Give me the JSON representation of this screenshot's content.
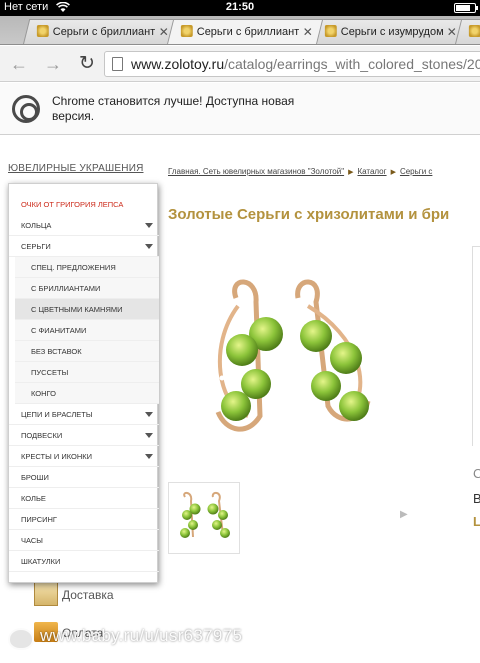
{
  "status_bar": {
    "carrier": "Нет сети",
    "time": "21:50",
    "battery_level": 0.8
  },
  "tabs": [
    {
      "title": "Серьги с бриллиант",
      "active": false
    },
    {
      "title": "Серьги с бриллиант",
      "active": true
    },
    {
      "title": "Серьги с изумрудом",
      "active": false
    }
  ],
  "toolbar": {
    "url_host": "www.zolotoy.ru",
    "url_path": "/catalog/earrings_with_colored_stones/20"
  },
  "infobar": {
    "message": "Chrome становится лучше! Доступна новая версия."
  },
  "site": {
    "catalog_link": "ЮВЕЛИРНЫЕ УКРАШЕНИЯ",
    "breadcrumb": [
      "Главная. Сеть ювелирных магазинов \"Золотой\"",
      "Каталог",
      "Серьги с"
    ],
    "page_title": "Золотые Серьги с хризолитами и бри",
    "right_panel": {
      "a": "С",
      "b": "В",
      "c": "L"
    },
    "delivery_label": "Доставка",
    "payment_label": "Оплата"
  },
  "menu": {
    "items": [
      {
        "label": "Очки от Григория Лепса",
        "type": "red"
      },
      {
        "label": "Кольца",
        "type": "top",
        "arrow": true
      },
      {
        "label": "Серьги",
        "type": "top",
        "arrow": true
      },
      {
        "label": "Спец. предложения",
        "type": "sub"
      },
      {
        "label": "С бриллиантами",
        "type": "sub"
      },
      {
        "label": "С цветными камнями",
        "type": "sub",
        "active": true
      },
      {
        "label": "С фианитами",
        "type": "sub"
      },
      {
        "label": "Без вставок",
        "type": "sub"
      },
      {
        "label": "Пуссеты",
        "type": "sub"
      },
      {
        "label": "Конго",
        "type": "sub"
      },
      {
        "label": "Цепи и браслеты",
        "type": "top",
        "arrow": true
      },
      {
        "label": "Подвески",
        "type": "top",
        "arrow": true
      },
      {
        "label": "Кресты и иконки",
        "type": "top",
        "arrow": true
      },
      {
        "label": "Броши",
        "type": "top"
      },
      {
        "label": "Колье",
        "type": "top"
      },
      {
        "label": "Пирсинг",
        "type": "top"
      },
      {
        "label": "Часы",
        "type": "top"
      },
      {
        "label": "Шкатулки",
        "type": "top"
      }
    ]
  },
  "watermark": {
    "text": "www.baby.ru/u/usr637975"
  },
  "colors": {
    "gold": "#b3923e",
    "menu_red": "#cc2a1a",
    "peridot": "#8cc43a"
  }
}
